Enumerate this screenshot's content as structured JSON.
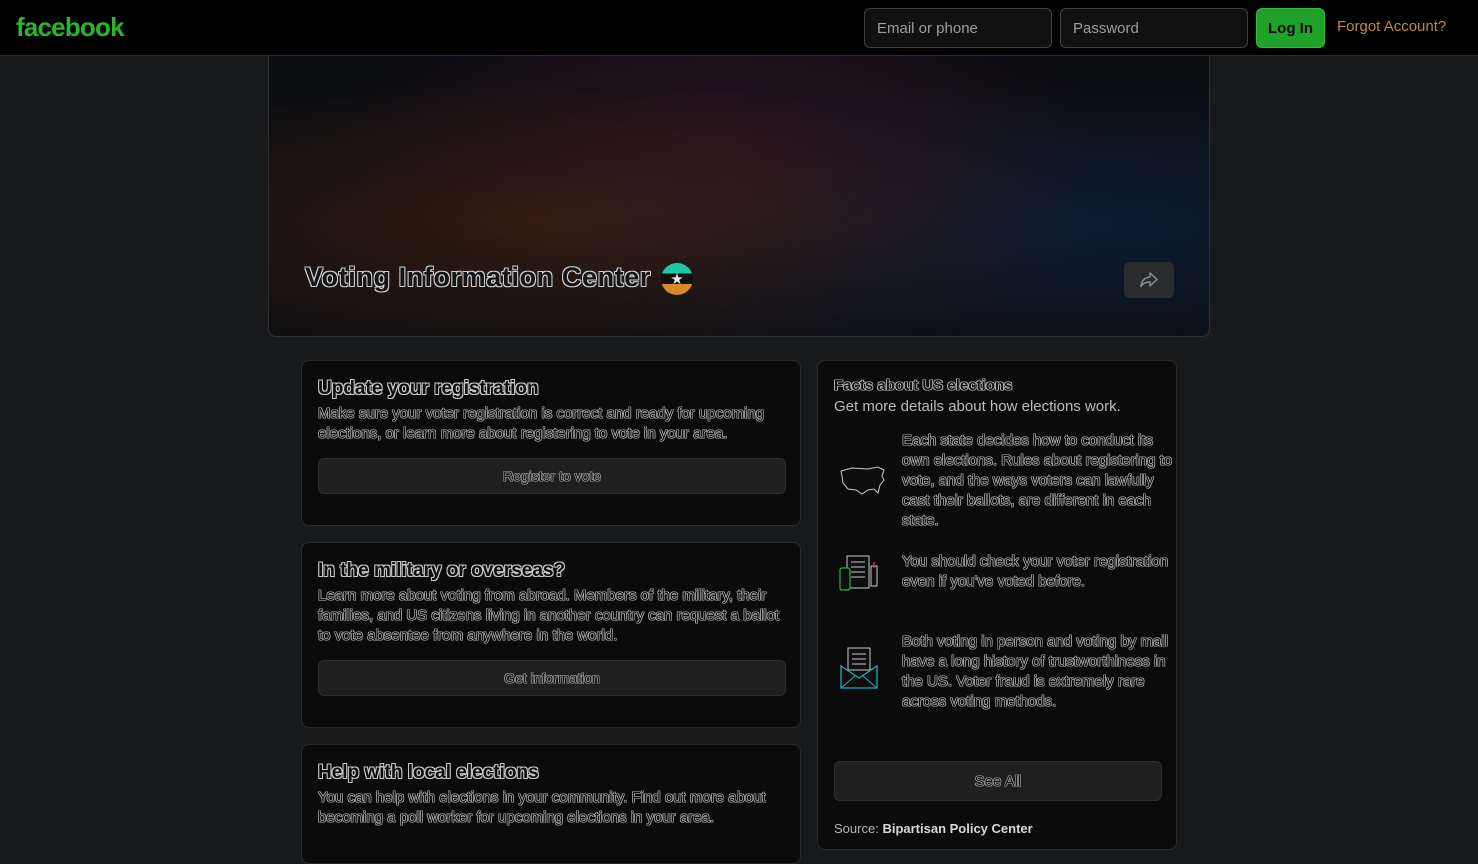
{
  "topbar": {
    "logo": "facebook",
    "email_placeholder": "Email or phone",
    "password_placeholder": "Password",
    "login_label": "Log In",
    "forgot_label": "Forgot Account?"
  },
  "hero": {
    "title": "Voting Information Center",
    "badge_icon": "star-icon",
    "share_icon": "share-icon"
  },
  "cards": [
    {
      "title": "Update your registration",
      "body": "Make sure your voter registration is correct and ready for upcoming elections, or learn more about registering to vote in your area.",
      "action": "Register to vote"
    },
    {
      "title": "In the military or overseas?",
      "body": "Learn more about voting from abroad. Members of the military, their families, and US citizens living in another country can request a ballot to vote absentee from anywhere in the world.",
      "action": "Get information"
    },
    {
      "title": "Help with local elections",
      "body": "You can help with elections in your community. Find out more about becoming a poll worker for upcoming elections in your area."
    }
  ],
  "facts": {
    "title": "Facts about US elections",
    "subtitle": "Get more details about how elections work.",
    "items": [
      {
        "icon": "us-map-icon",
        "text": "Each state decides how to conduct its own elections. Rules about registering to vote, and the ways voters can lawfully cast their ballots, are different in each state."
      },
      {
        "icon": "devices-checklist-icon",
        "text": "You should check your voter registration even if you've voted before."
      },
      {
        "icon": "mail-ballot-icon",
        "text": "Both voting in person and voting by mail have a long history of trustworthiness in the US. Voter fraud is extremely rare across voting methods."
      }
    ],
    "see_all": "See All",
    "source_prefix": "Source:",
    "source_name": "Bipartisan Policy Center"
  },
  "colors": {
    "brand_green": "#2bb52b",
    "login_green": "#1fa12a",
    "forgot_orange": "#c3893a",
    "background": "#18191a"
  }
}
